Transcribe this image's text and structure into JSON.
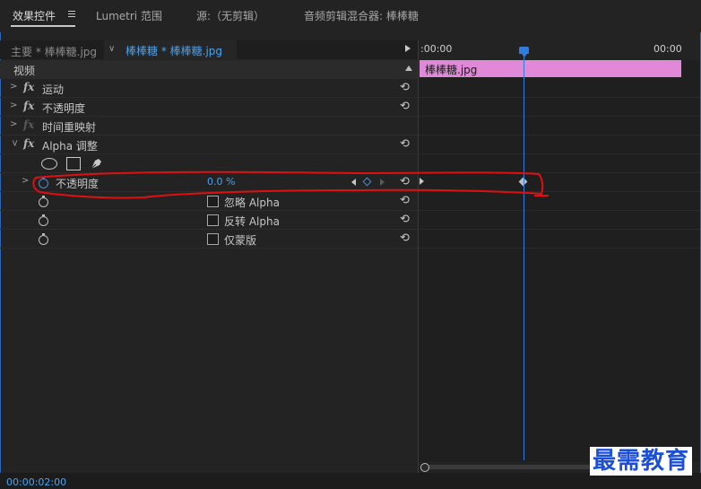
{
  "tabs": {
    "effects_controls": "效果控件",
    "lumetri": "Lumetri 范围",
    "source": "源:（无剪辑）",
    "audio_mixer": "音频剪辑混合器: 棒棒糖"
  },
  "source_bar": {
    "master_tab": "主要 * 棒棒糖.jpg",
    "clip_tab": "棒棒糖 * 棒棒糖.jpg"
  },
  "sections": {
    "video_header": "视频",
    "motion": "运动",
    "opacity": "不透明度",
    "time_remap": "时间重映射",
    "alpha_adjust": "Alpha 调整"
  },
  "alpha_params": {
    "opacity_label": "不透明度",
    "opacity_value": "0.0 %",
    "ignore_alpha": "忽略 Alpha",
    "invert_alpha": "反转 Alpha",
    "mask_only": "仅蒙版"
  },
  "timeline": {
    "start_label": ":00:00",
    "end_label": "00:00",
    "clip_name": "棒棒糖.jpg"
  },
  "timecode": "00:00:02:00",
  "watermark": "最需教育",
  "icons": {
    "fx": "fx",
    "reset": "⟲"
  },
  "colors": {
    "accent_blue": "#4aa3f0",
    "clip_pink": "#e089d9",
    "annotation_red": "#e01010",
    "panel_bg": "#232323"
  }
}
